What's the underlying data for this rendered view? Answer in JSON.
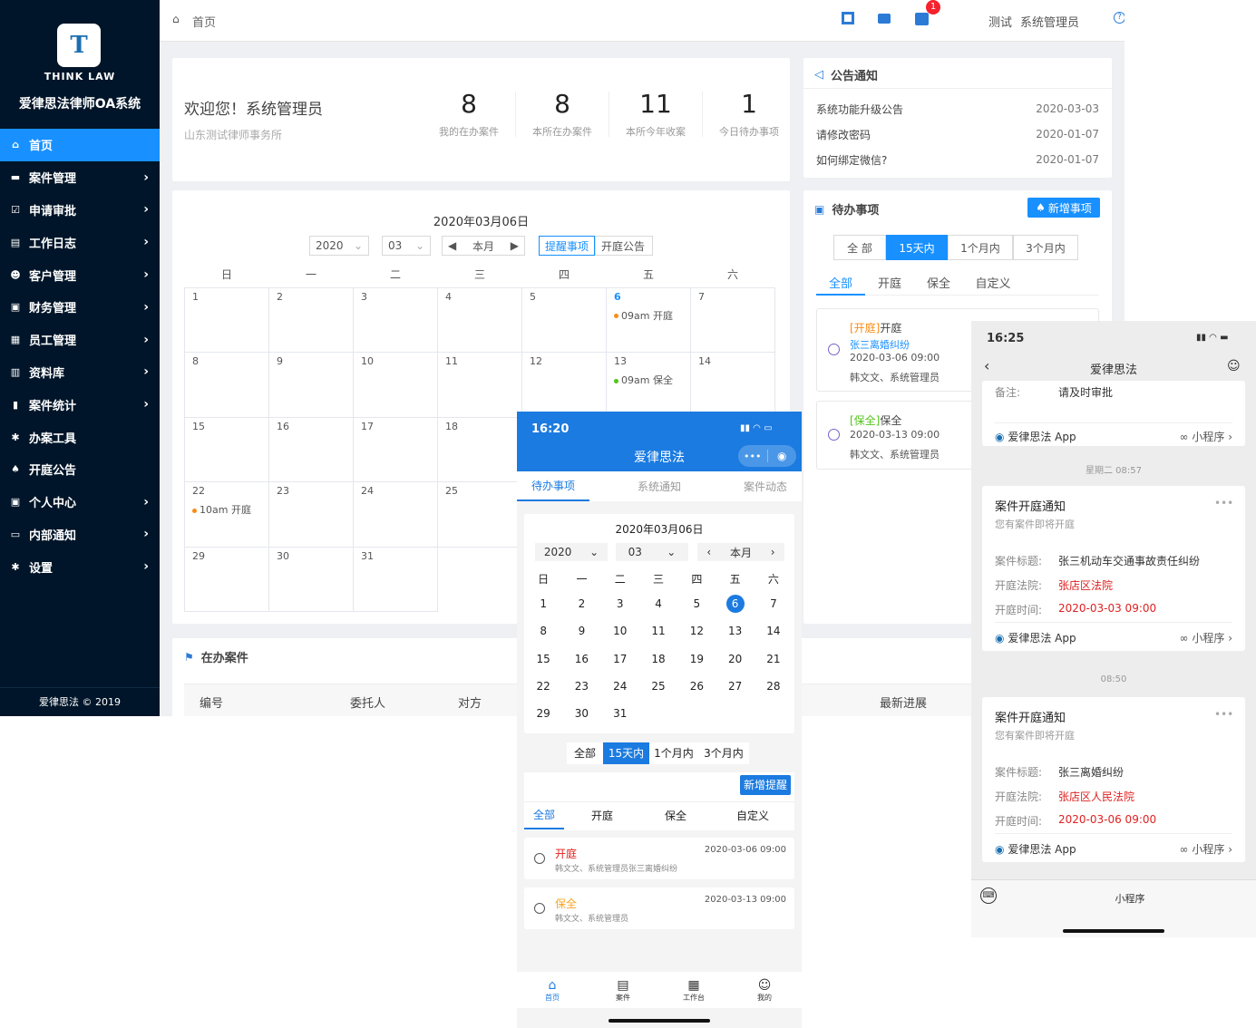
{
  "sidebar": {
    "logo_text": "THINK LAW",
    "app_name": "爱律思法律师OA系统",
    "items": [
      {
        "label": "首页",
        "icon": "home-icon",
        "active": true
      },
      {
        "label": "案件管理",
        "icon": "folder-icon"
      },
      {
        "label": "申请审批",
        "icon": "check-icon"
      },
      {
        "label": "工作日志",
        "icon": "doc-icon"
      },
      {
        "label": "客户管理",
        "icon": "users-icon"
      },
      {
        "label": "财务管理",
        "icon": "money-icon"
      },
      {
        "label": "员工管理",
        "icon": "id-card-icon"
      },
      {
        "label": "资料库",
        "icon": "book-icon"
      },
      {
        "label": "案件统计",
        "icon": "chart-icon"
      },
      {
        "label": "办案工具",
        "icon": "gear-icon"
      },
      {
        "label": "开庭公告",
        "icon": "bell-icon"
      },
      {
        "label": "个人中心",
        "icon": "person-icon"
      },
      {
        "label": "内部通知",
        "icon": "message-icon"
      },
      {
        "label": "设置",
        "icon": "settings-icon"
      }
    ],
    "footer": "爱律思法 © 2019"
  },
  "topbar": {
    "breadcrumb": "首页",
    "badge": "1",
    "user_org": "测试",
    "user_name": "系统管理员"
  },
  "welcome": {
    "title": "欢迎您！系统管理员",
    "org": "山东测试律师事务所",
    "stats": [
      {
        "value": "8",
        "label": "我的在办案件"
      },
      {
        "value": "8",
        "label": "本所在办案件"
      },
      {
        "value": "11",
        "label": "本所今年收案"
      },
      {
        "value": "1",
        "label": "今日待办事项"
      }
    ]
  },
  "notice": {
    "title": "公告通知",
    "items": [
      {
        "title": "系统功能升级公告",
        "date": "2020-03-03"
      },
      {
        "title": "请修改密码",
        "date": "2020-01-07"
      },
      {
        "title": "如何绑定微信?",
        "date": "2020-01-07"
      }
    ]
  },
  "calendar": {
    "title": "2020年03月06日",
    "year": "2020",
    "month": "03",
    "this_month": "本月",
    "tab_remind": "提醒事项",
    "tab_court": "开庭公告",
    "weekdays": [
      "日",
      "一",
      "二",
      "三",
      "四",
      "五",
      "六"
    ],
    "events": {
      "6": "09am 开庭",
      "13": "09am 保全",
      "22": "10am 开庭"
    }
  },
  "todo": {
    "title": "待办事项",
    "add_button": "新增事项",
    "ranges": [
      "全 部",
      "15天内",
      "1个月内",
      "3个月内"
    ],
    "types": [
      "全部",
      "开庭",
      "保全",
      "自定义"
    ],
    "items": [
      {
        "tag": "[开庭]",
        "title": "开庭",
        "case": "张三离婚纠纷",
        "time": "2020-03-06 09:00",
        "people": "韩文文、系统管理员"
      },
      {
        "tag": "[保全]",
        "title": "保全",
        "case": "",
        "time": "2020-03-13 09:00",
        "people": "韩文文、系统管理员"
      }
    ]
  },
  "cases": {
    "title": "在办案件",
    "columns": [
      "编号",
      "委托人",
      "对方",
      "最新进展"
    ]
  },
  "phone1": {
    "time": "16:20",
    "title": "爱律思法",
    "tabs": [
      "待办事项",
      "系统通知",
      "案件动态"
    ],
    "cal_title": "2020年03月06日",
    "year": "2020",
    "month": "03",
    "this_month": "本月",
    "weekdays": [
      "日",
      "一",
      "二",
      "三",
      "四",
      "五",
      "六"
    ],
    "ranges": [
      "全部",
      "15天内",
      "1个月内",
      "3个月内"
    ],
    "add_button": "新增提醒",
    "types": [
      "全部",
      "开庭",
      "保全",
      "自定义"
    ],
    "items": [
      {
        "title": "开庭",
        "time": "2020-03-06 09:00",
        "desc": "韩文文、系统管理员张三离婚纠纷"
      },
      {
        "title": "保全",
        "time": "2020-03-13 09:00",
        "desc": "韩文文、系统管理员"
      }
    ],
    "nav": [
      "首页",
      "案件",
      "工作台",
      "我的"
    ]
  },
  "phone2": {
    "time": "16:25",
    "title": "爱律思法",
    "remark_key": "备注:",
    "remark_val": "请及时审批",
    "app_name": "爱律思法 App",
    "mini": "小程序",
    "time1": "星期二 08:57",
    "time2": "08:50",
    "messages": [
      {
        "title": "案件开庭通知",
        "sub": "您有案件即将开庭",
        "case_key": "案件标题:",
        "case": "张三机动车交通事故责任纠纷",
        "court_key": "开庭法院:",
        "court": "张店区法院",
        "time_key": "开庭时间:",
        "time": "2020-03-03 09:00"
      },
      {
        "title": "案件开庭通知",
        "sub": "您有案件即将开庭",
        "case_key": "案件标题:",
        "case": "张三离婚纠纷",
        "court_key": "开庭法院:",
        "court": "张店区人民法院",
        "time_key": "开庭时间:",
        "time": "2020-03-06 09:00"
      }
    ],
    "bottom": "小程序"
  }
}
